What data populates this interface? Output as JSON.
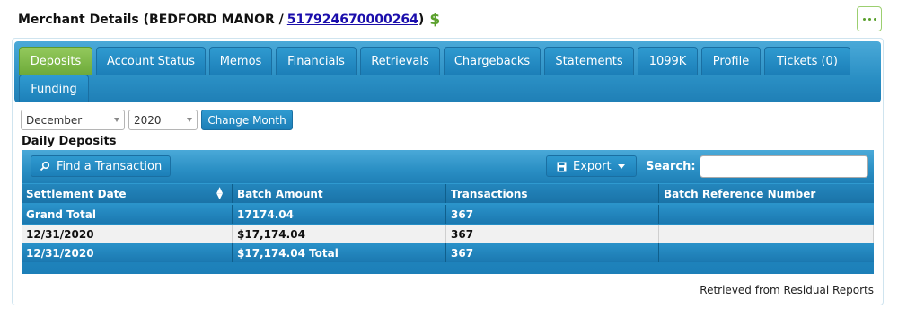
{
  "header": {
    "title_prefix": "Merchant Details (BEDFORD MANOR /",
    "merchant_id": "517924670000264",
    "title_suffix": ")",
    "dollar_icon": "$"
  },
  "tabs": [
    {
      "label": "Deposits",
      "active": true
    },
    {
      "label": "Account Status"
    },
    {
      "label": "Memos"
    },
    {
      "label": "Financials"
    },
    {
      "label": "Retrievals"
    },
    {
      "label": "Chargebacks"
    },
    {
      "label": "Statements"
    },
    {
      "label": "1099K"
    },
    {
      "label": "Profile"
    },
    {
      "label": "Tickets (0)"
    },
    {
      "label": "Funding"
    }
  ],
  "filters": {
    "month": "December",
    "year": "2020",
    "change_month_label": "Change Month"
  },
  "section": {
    "title": "Daily Deposits"
  },
  "toolbar": {
    "find_label": "Find a Transaction",
    "export_label": "Export",
    "search_label": "Search:",
    "search_value": ""
  },
  "table": {
    "columns": [
      "Settlement Date",
      "Batch Amount",
      "Transactions",
      "Batch Reference Number"
    ],
    "grand_total": [
      "Grand Total",
      "17174.04",
      "367",
      ""
    ],
    "rows": [
      [
        "12/31/2020",
        "$17,174.04",
        "367",
        ""
      ]
    ],
    "subtotal": [
      "12/31/2020",
      "$17,174.04 Total",
      "367",
      ""
    ]
  },
  "footer": {
    "note": "Retrieved from Residual Reports"
  },
  "colors": {
    "accent_blue": "#1f7fb6",
    "active_tab_green": "#6eaa3a",
    "link": "#1a0dab",
    "dollar_green": "#5aa02c"
  }
}
